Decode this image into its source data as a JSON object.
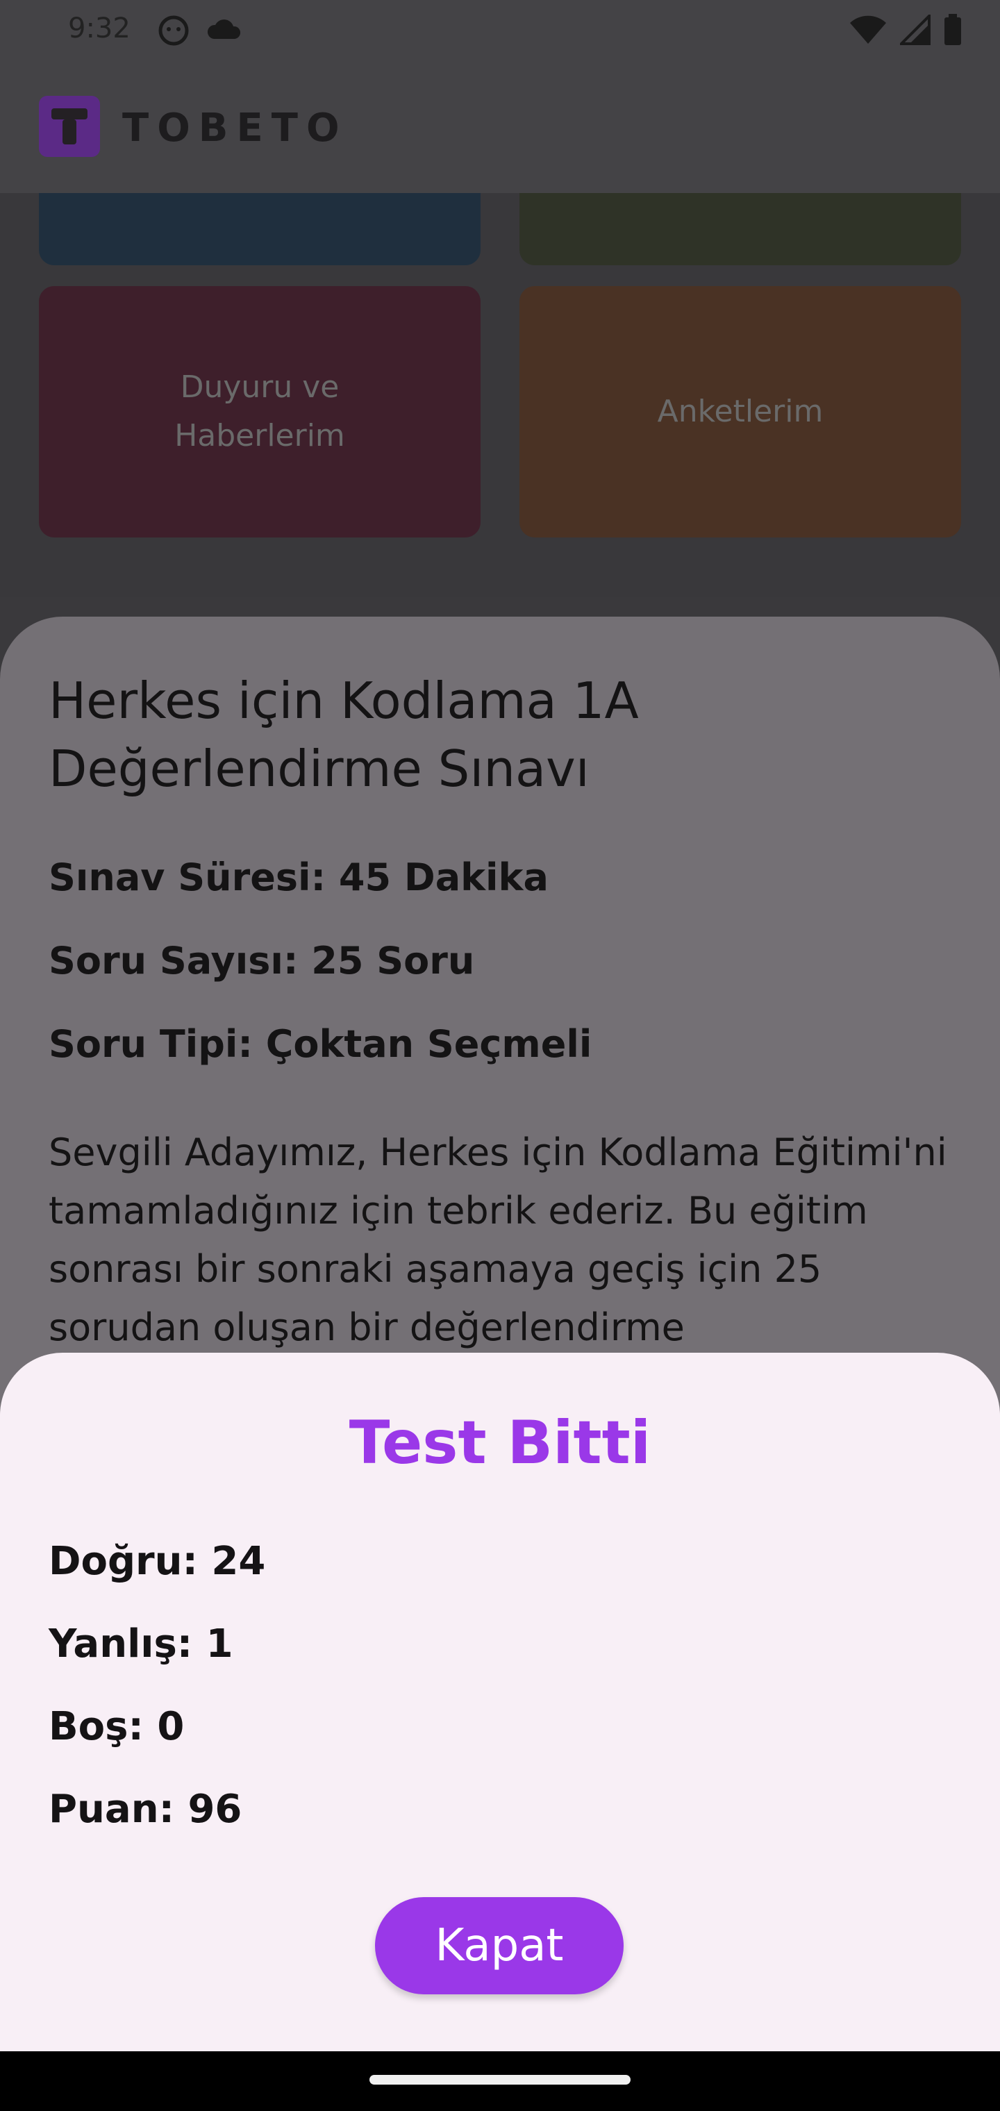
{
  "status_bar": {
    "time": "9:32",
    "left_icons": [
      "face-icon",
      "cloud-icon"
    ],
    "right_icons": [
      "wifi-icon",
      "signal-icon",
      "battery-icon"
    ]
  },
  "header": {
    "logo_text": "TOBETO"
  },
  "tiles": [
    {
      "label": "",
      "color": "#1f2f3e"
    },
    {
      "label": "",
      "color": "#2f3327"
    },
    {
      "label": "Duyuru ve\nHaberlerim",
      "color": "#3e1f2b"
    },
    {
      "label": "Anketlerim",
      "color": "#4a3224"
    }
  ],
  "exam": {
    "title": "Herkes için Kodlama 1A Değerlendirme Sınavı",
    "duration": "Sınav Süresi: 45 Dakika",
    "question_count": "Soru Sayısı: 25 Soru",
    "question_type": "Soru Tipi: Çoktan Seçmeli",
    "description": "Sevgili Adayımız,  Herkes için Kodlama Eğitimi'ni tamamladığınız için tebrik ederiz. Bu eğitim sonrası bir sonraki aşamaya geçiş için 25 sorudan oluşan bir değerlendirme"
  },
  "result": {
    "title": "Test Bitti",
    "correct": "Doğru: 24",
    "wrong": "Yanlış: 1",
    "empty": "Boş: 0",
    "score": "Puan: 96",
    "close_label": "Kapat"
  },
  "colors": {
    "accent": "#9a38e8",
    "sheet_bg": "#f8eff6"
  }
}
